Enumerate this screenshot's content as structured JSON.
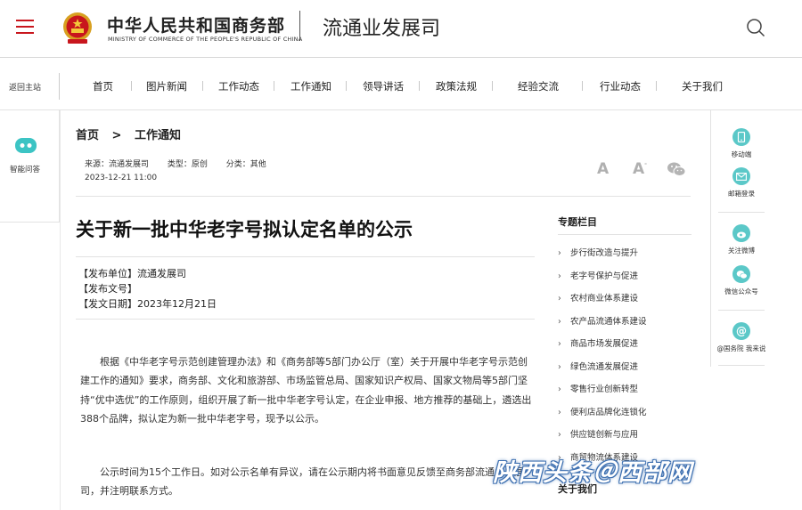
{
  "header": {
    "org_cn": "中华人民共和国商务部",
    "org_en": "MINISTRY OF COMMERCE OF THE PEOPLE'S REPUBLIC OF CHINA",
    "dept_name": "流通业发展司",
    "brand_color": "#c8161d"
  },
  "nav": {
    "back_home": "返回主站",
    "items": [
      "首页",
      "图片新闻",
      "工作动态",
      "工作通知",
      "领导讲话",
      "政策法规",
      "经验交流",
      "行业动态",
      "关于我们"
    ]
  },
  "left_panel": {
    "label": "智能问答"
  },
  "right_panel": {
    "items": [
      "移动端",
      "邮箱登录",
      "关注微博",
      "微信公众号",
      "@国务院 我来说"
    ]
  },
  "breadcrumb": {
    "home": "首页",
    "sep": ">",
    "current": "工作通知"
  },
  "meta": {
    "source": "来源：流通发展司",
    "type": "类型：原创",
    "category": "分类：其他",
    "date": "2023-12-21 11:00",
    "font_large": "A",
    "font_small": "A",
    "font_small_sup": "-"
  },
  "article": {
    "title": "关于新一批中华老字号拟认定名单的公示",
    "publisher": "【发布单位】流通发展司",
    "doc_no": "【发布文号】",
    "pub_date": "【发文日期】2023年12月21日",
    "para1": "根据《中华老字号示范创建管理办法》和《商务部等5部门办公厅（室）关于开展中华老字号示范创建工作的通知》要求，商务部、文化和旅游部、市场监管总局、国家知识产权局、国家文物局等5部门坚持“优中选优”的工作原则，组织开展了新一批中华老字号认定，在企业申报、地方推荐的基础上，遴选出388个品牌，拟认定为新一批中华老字号，现予以公示。",
    "para2": "公示时间为15个工作日。如对公示名单有异议，请在公示期内将书面意见反馈至商务部流通业发展司，并注明联系方式。"
  },
  "sidebar": {
    "title": "专题栏目",
    "items": [
      "步行街改造与提升",
      "老字号保护与促进",
      "农村商业体系建设",
      "农产品流通体系建设",
      "商品市场发展促进",
      "绿色流通发展促进",
      "零售行业创新转型",
      "便利店品牌化连锁化",
      "供应链创新与应用",
      "商贸物流体系建设"
    ],
    "bottom_title": "关于我们"
  },
  "watermark": "陕西头条＠西部网",
  "colors": {
    "accent_teal": "#5bc8c8",
    "watermark_blue": "#3d6fb0"
  }
}
